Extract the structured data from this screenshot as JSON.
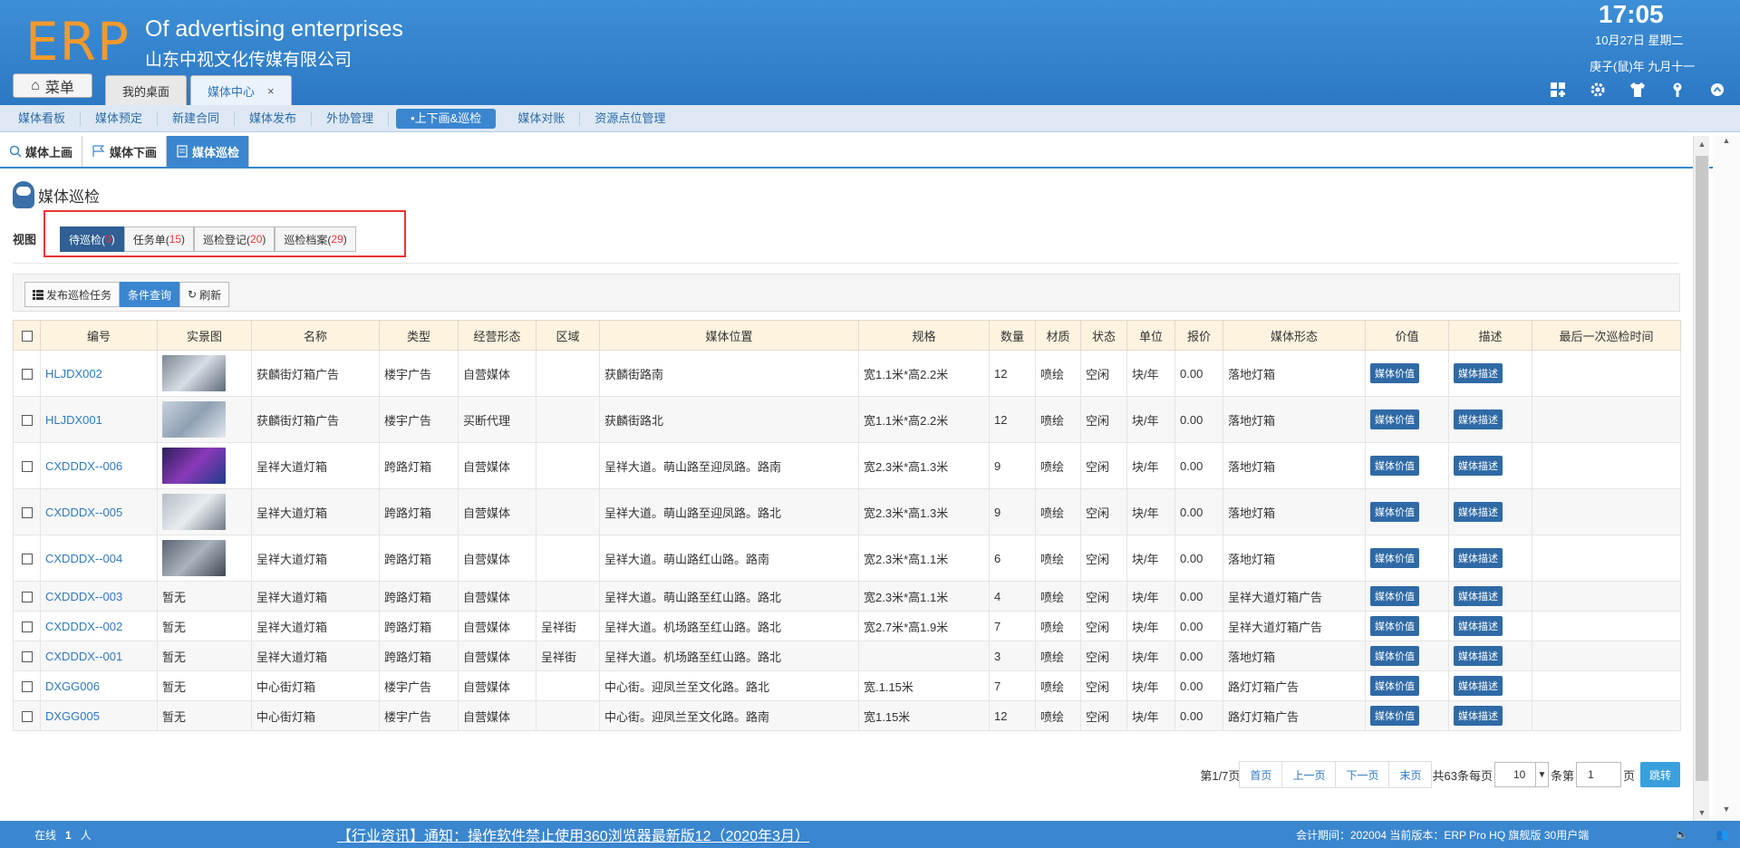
{
  "header": {
    "logo": "ERP",
    "company_en": "Of advertising enterprises",
    "company_cn": "山东中视文化传媒有限公司",
    "time": "17:05",
    "date": "10月27日 星期二",
    "lunar": "庚子(鼠)年 九月十一"
  },
  "menu_label": "菜单",
  "top_tabs": [
    {
      "label": "我的桌面"
    },
    {
      "label": "媒体中心",
      "close": "×"
    }
  ],
  "nav": [
    "媒体看板",
    "媒体预定",
    "新建合同",
    "媒体发布",
    "外协管理",
    "•上下画&巡检",
    "媒体对账",
    "资源点位管理"
  ],
  "sub_tabs": [
    "媒体上画",
    "媒体下画",
    "媒体巡检"
  ],
  "page_title": "媒体巡检",
  "view_label": "视图",
  "view_buttons": [
    {
      "label": "待巡检(",
      "count": "0",
      "close": ")"
    },
    {
      "label": "任务单(",
      "count": "15",
      "close": ")"
    },
    {
      "label": "巡检登记(",
      "count": "20",
      "close": ")"
    },
    {
      "label": "巡检档案(",
      "count": "29",
      "close": ")"
    }
  ],
  "toolbar": {
    "publish": "发布巡检任务",
    "query": "条件查询",
    "refresh": "刷新"
  },
  "columns": [
    "编号",
    "实景图",
    "名称",
    "类型",
    "经营形态",
    "区域",
    "媒体位置",
    "规格",
    "数量",
    "材质",
    "状态",
    "单位",
    "报价",
    "媒体形态",
    "价值",
    "描述",
    "最后一次巡检时间"
  ],
  "rows": [
    {
      "code": "HLJDX002",
      "img": "thumb",
      "name": "获麟街灯箱广告",
      "type": "楼宇广告",
      "mode": "自营媒体",
      "area": "",
      "loc": "获麟街路南",
      "spec": "宽1.1米*高2.2米",
      "qty": "12",
      "mat": "喷绘",
      "status": "空闲",
      "unit": "块/年",
      "price": "0.00",
      "form": "落地灯箱",
      "value_btn": "媒体价值",
      "desc_btn": "媒体描述",
      "last": ""
    },
    {
      "code": "HLJDX001",
      "img": "thumb",
      "name": "获麟街灯箱广告",
      "type": "楼宇广告",
      "mode": "买断代理",
      "area": "",
      "loc": "获麟街路北",
      "spec": "宽1.1米*高2.2米",
      "qty": "12",
      "mat": "喷绘",
      "status": "空闲",
      "unit": "块/年",
      "price": "0.00",
      "form": "落地灯箱",
      "value_btn": "媒体价值",
      "desc_btn": "媒体描述",
      "last": ""
    },
    {
      "code": "CXDDDX--006",
      "img": "thumb",
      "name": "呈祥大道灯箱",
      "type": "跨路灯箱",
      "mode": "自营媒体",
      "area": "",
      "loc": "呈祥大道。萌山路至迎凤路。路南",
      "spec": "宽2.3米*高1.3米",
      "qty": "9",
      "mat": "喷绘",
      "status": "空闲",
      "unit": "块/年",
      "price": "0.00",
      "form": "落地灯箱",
      "value_btn": "媒体价值",
      "desc_btn": "媒体描述",
      "last": ""
    },
    {
      "code": "CXDDDX--005",
      "img": "thumb",
      "name": "呈祥大道灯箱",
      "type": "跨路灯箱",
      "mode": "自营媒体",
      "area": "",
      "loc": "呈祥大道。萌山路至迎凤路。路北",
      "spec": "宽2.3米*高1.3米",
      "qty": "9",
      "mat": "喷绘",
      "status": "空闲",
      "unit": "块/年",
      "price": "0.00",
      "form": "落地灯箱",
      "value_btn": "媒体价值",
      "desc_btn": "媒体描述",
      "last": ""
    },
    {
      "code": "CXDDDX--004",
      "img": "thumb",
      "name": "呈祥大道灯箱",
      "type": "跨路灯箱",
      "mode": "自营媒体",
      "area": "",
      "loc": "呈祥大道。萌山路红山路。路南",
      "spec": "宽2.3米*高1.1米",
      "qty": "6",
      "mat": "喷绘",
      "status": "空闲",
      "unit": "块/年",
      "price": "0.00",
      "form": "落地灯箱",
      "value_btn": "媒体价值",
      "desc_btn": "媒体描述",
      "last": ""
    },
    {
      "code": "CXDDDX--003",
      "img": "暂无",
      "name": "呈祥大道灯箱",
      "type": "跨路灯箱",
      "mode": "自营媒体",
      "area": "",
      "loc": "呈祥大道。萌山路至红山路。路北",
      "spec": "宽2.3米*高1.1米",
      "qty": "4",
      "mat": "喷绘",
      "status": "空闲",
      "unit": "块/年",
      "price": "0.00",
      "form": "呈祥大道灯箱广告",
      "value_btn": "媒体价值",
      "desc_btn": "媒体描述",
      "last": ""
    },
    {
      "code": "CXDDDX--002",
      "img": "暂无",
      "name": "呈祥大道灯箱",
      "type": "跨路灯箱",
      "mode": "自营媒体",
      "area": "呈祥街",
      "loc": "呈祥大道。机场路至红山路。路北",
      "spec": "宽2.7米*高1.9米",
      "qty": "7",
      "mat": "喷绘",
      "status": "空闲",
      "unit": "块/年",
      "price": "0.00",
      "form": "呈祥大道灯箱广告",
      "value_btn": "媒体价值",
      "desc_btn": "媒体描述",
      "last": ""
    },
    {
      "code": "CXDDDX--001",
      "img": "暂无",
      "name": "呈祥大道灯箱",
      "type": "跨路灯箱",
      "mode": "自营媒体",
      "area": "呈祥街",
      "loc": "呈祥大道。机场路至红山路。路北",
      "spec": "",
      "qty": "3",
      "mat": "喷绘",
      "status": "空闲",
      "unit": "块/年",
      "price": "0.00",
      "form": "落地灯箱",
      "value_btn": "媒体价值",
      "desc_btn": "媒体描述",
      "last": ""
    },
    {
      "code": "DXGG006",
      "img": "暂无",
      "name": "中心街灯箱",
      "type": "楼宇广告",
      "mode": "自营媒体",
      "area": "",
      "loc": "中心街。迎凤兰至文化路。路北",
      "spec": "宽.1.15米",
      "qty": "7",
      "mat": "喷绘",
      "status": "空闲",
      "unit": "块/年",
      "price": "0.00",
      "form": "路灯灯箱广告",
      "value_btn": "媒体价值",
      "desc_btn": "媒体描述",
      "last": ""
    },
    {
      "code": "DXGG005",
      "img": "暂无",
      "name": "中心街灯箱",
      "type": "楼宇广告",
      "mode": "自营媒体",
      "area": "",
      "loc": "中心街。迎凤兰至文化路。路南",
      "spec": "宽1.15米",
      "qty": "12",
      "mat": "喷绘",
      "status": "空闲",
      "unit": "块/年",
      "price": "0.00",
      "form": "路灯灯箱广告",
      "value_btn": "媒体价值",
      "desc_btn": "媒体描述",
      "last": ""
    }
  ],
  "pager": {
    "page_info": "第1/7页",
    "first": "首页",
    "prev": "上一页",
    "next": "下一页",
    "last": "末页",
    "total": "共63条每页",
    "per_page": "10",
    "per_suffix": "条第",
    "page_input": "1",
    "page_suffix": "页",
    "go": "跳转"
  },
  "footer": {
    "online_label": "在线",
    "online_count": "1",
    "online_unit": "人",
    "news": "【行业资讯】通知：操作软件禁止使用360浏览器最新版12（2020年3月）",
    "info": "会计期间：202004 当前版本：ERP Pro HQ 旗舰版 30用户端"
  }
}
